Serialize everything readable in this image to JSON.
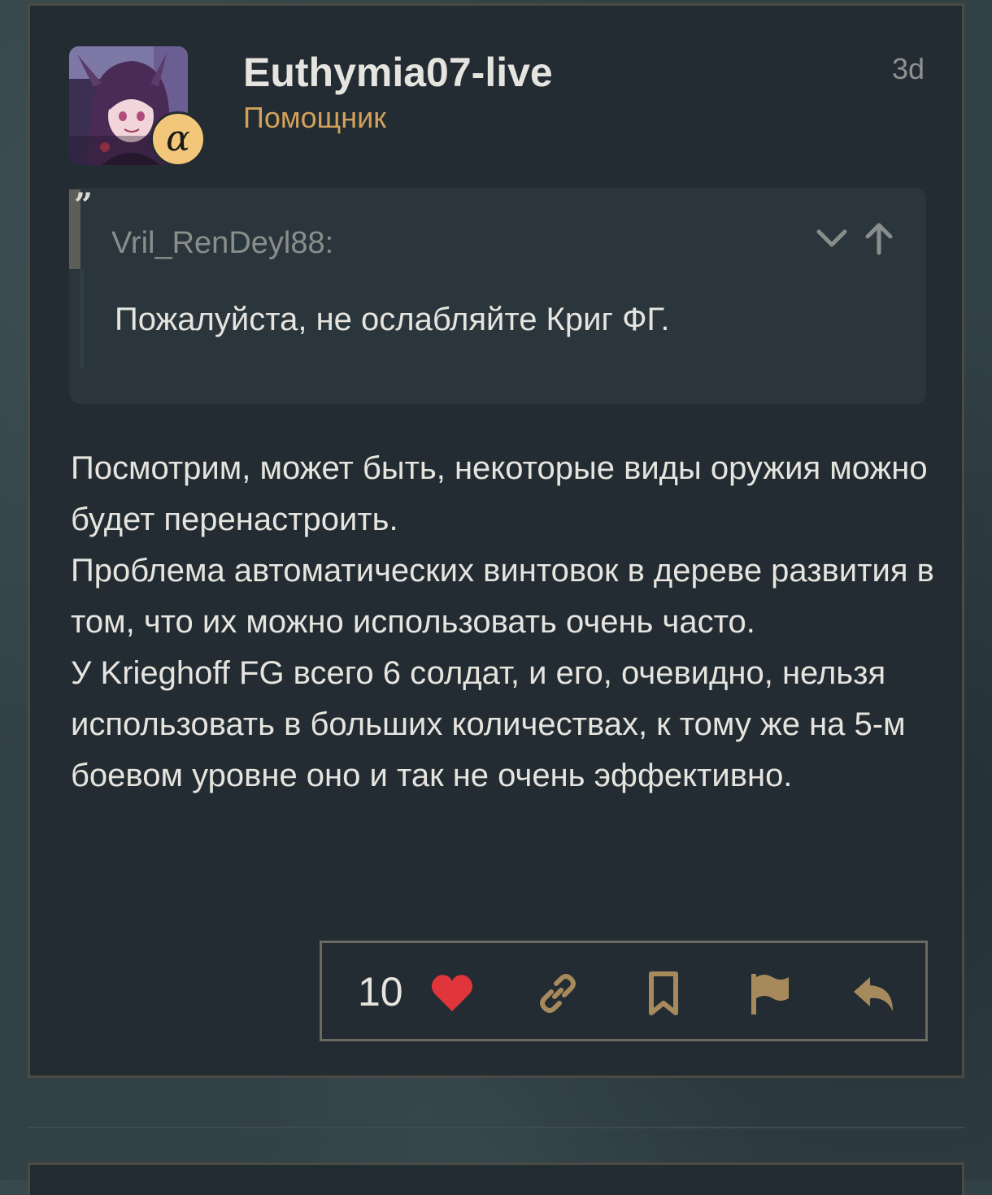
{
  "post": {
    "username": "Euthymia07-live",
    "user_title": "Помощник",
    "date": "3d",
    "badge_symbol": "α",
    "avatar_icon": "anime-avatar",
    "quote": {
      "author": "Vril_RenDeyl88:",
      "text": "Пожалуйста, не ослабляйте Криг ФГ.",
      "expand_icon": "chevron-down-icon",
      "jump_icon": "arrow-up-icon",
      "quote_icon": "quote-icon"
    },
    "body": {
      "paragraph_1": "Посмотрим, может быть, некоторые виды оружия можно будет перенастроить.",
      "paragraph_2": "Проблема автоматических винтовок в дереве развития в том, что их можно использовать очень часто.",
      "paragraph_3": "У Krieghoff FG всего 6 солдат, и его, очевидно, нельзя использовать в больших количествах, к тому же на 5-м боевом уровне оно и так не очень эффективно."
    },
    "actions": {
      "like_count": "10",
      "icons": [
        "heart-icon",
        "link-icon",
        "bookmark-icon",
        "flag-icon",
        "reply-icon"
      ]
    }
  },
  "colors": {
    "background": "#324146",
    "card": "#222c32",
    "card_border": "#4a4b44",
    "quote_bg": "#2a363c",
    "text": "#e6e4de",
    "muted": "#8e928e",
    "accent_gold": "#d2a25c",
    "action_icon": "#a78a5c",
    "heart": "#e0353a",
    "badge": "#f3c77a"
  }
}
